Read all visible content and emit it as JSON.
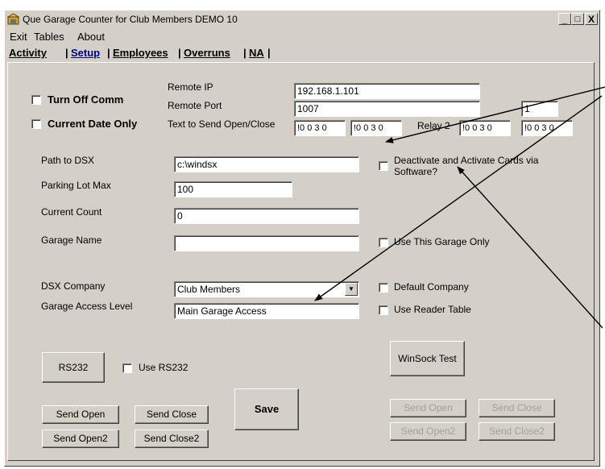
{
  "window": {
    "title": "Que Garage Counter for Club Members DEMO  10",
    "controls": {
      "minimize": "_",
      "maximize": "□",
      "close": "X"
    }
  },
  "menu": {
    "items": [
      "Exit",
      "Tables",
      "About"
    ]
  },
  "tabs": [
    {
      "label": "Activity",
      "active": false
    },
    {
      "label": "Setup",
      "active": true
    },
    {
      "label": "Employees",
      "active": false
    },
    {
      "label": "Overruns",
      "active": false
    },
    {
      "label": "NA",
      "active": false
    }
  ],
  "tab_separator": "|",
  "options": {
    "turn_off_comm": {
      "label": "Turn Off Comm",
      "checked": false
    },
    "current_date_only": {
      "label": "Current Date Only",
      "checked": false
    }
  },
  "remote": {
    "ip_label": "Remote IP",
    "ip_value": "192.168.1.101",
    "port_label": "Remote Port",
    "port_value": "1007",
    "extra_value": "1",
    "send_label": "Text to Send Open/Close",
    "send_open": "!0 0 3 0",
    "send_close": "!0 0 3 0",
    "relay2_label": "Relay 2",
    "relay2_open": "!0 0 3 0",
    "relay2_close": "!0 0 3 0"
  },
  "settings": {
    "path_label": "Path to DSX",
    "path_value": "c:\\windsx",
    "lot_max_label": "Parking Lot Max",
    "lot_max_value": "100",
    "count_label": "Current Count",
    "count_value": "0",
    "garage_name_label": "Garage Name",
    "garage_name_value": "",
    "company_label": "DSX Company",
    "company_value": "Club Members",
    "access_level_label": "Garage Access Level",
    "access_level_value": "Main Garage Access"
  },
  "checks": {
    "deactivate": {
      "label": "Deactivate and Activate Cards via Software?",
      "line1": "Deactivate and Activate Cards via",
      "line2": "Software?",
      "checked": false
    },
    "use_this_garage": {
      "label": "Use This Garage Only",
      "checked": false
    },
    "default_company": {
      "label": "Default Company",
      "checked": false
    },
    "use_reader_table": {
      "label": "Use Reader Table",
      "checked": false
    },
    "use_rs232": {
      "label": "Use RS232",
      "checked": false
    }
  },
  "buttons": {
    "rs232": "RS232",
    "save": "Save",
    "winsock_test": "WinSock Test",
    "send_open": "Send Open",
    "send_close": "Send Close",
    "send_open2": "Send Open2",
    "send_close2": "Send Close2",
    "ws_send_open": "Send Open",
    "ws_send_close": "Send Close",
    "ws_send_open2": "Send Open2",
    "ws_send_close2": "Send Close2"
  },
  "icons": {
    "app": "garage-app-icon",
    "dropdown": "chevron-down-icon"
  },
  "colors": {
    "window_face": "#d4d0c8",
    "active_tab": "#000080",
    "disabled_text": "#a0a0a0"
  }
}
